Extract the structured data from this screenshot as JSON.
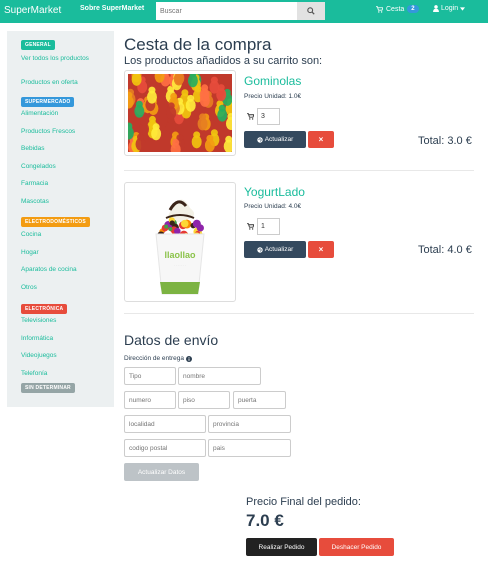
{
  "navbar": {
    "brand": "SuperMarket",
    "about": "Sobre SuperMarket",
    "search_placeholder": "Buscar",
    "cart_label": "Cesta",
    "cart_count": "2",
    "login_label": "Login"
  },
  "sidebar": {
    "sections": [
      {
        "badge": "GENERAL",
        "color": "#1abc9c",
        "items": [
          "Ver todos los productos",
          "Productos en oferta"
        ]
      },
      {
        "badge": "SUPERMERCADO",
        "color": "#3498db",
        "items": [
          "Alimentación",
          "Productos Frescos",
          "Bebidas",
          "Congelados",
          "Farmacia",
          "Mascotas"
        ]
      },
      {
        "badge": "ELECTRODOMÉSTICOS",
        "color": "#f39c12",
        "items": [
          "Cocina",
          "Hogar",
          "Aparatos de cocina",
          "Otros"
        ]
      },
      {
        "badge": "ELECTRÓNICA",
        "color": "#e74c3c",
        "items": [
          "Televisiones",
          "Informática",
          "Videojuegos",
          "Telefonía"
        ]
      },
      {
        "badge": "SIN DETERMINAR",
        "color": "#95a5a6",
        "items": []
      }
    ]
  },
  "main": {
    "title": "Cesta de la compra",
    "subtitle": "Los productos añadidos a su carrito son:"
  },
  "products": [
    {
      "name": "Gominolas",
      "unit_price": "Precio Unidad: 1.0€",
      "qty": "3",
      "update_label": "Actualizar",
      "remove_label": "×",
      "total": "Total: 3.0 €",
      "image": "gummy-bears"
    },
    {
      "name": "YogurtLado",
      "unit_price": "Precio Unidad: 4.0€",
      "qty": "1",
      "update_label": "Actualizar",
      "remove_label": "×",
      "total": "Total: 4.0 €",
      "image": "frozen-yogurt-cup",
      "cup_brand": "llaollao"
    }
  ],
  "shipping": {
    "title": "Datos de envío",
    "address_label": "Dirección de entrega",
    "placeholders": {
      "tipo": "Tipo",
      "nombre": "nombre",
      "numero": "numero",
      "piso": "piso",
      "puerta": "puerta",
      "localidad": "localidad",
      "provincia": "provincia",
      "codigo_postal": "codigo postal",
      "pais": "pais"
    },
    "update_button": "Actualizar Datos"
  },
  "summary": {
    "final_label": "Precio Final del pedido:",
    "final_amount": "7.0 €",
    "order_button": "Realizar Pedido",
    "undo_button": "Deshacer Pedido"
  },
  "colors": {
    "brand": "#1abc9c",
    "dark": "#34495e",
    "danger": "#e74c3c"
  }
}
